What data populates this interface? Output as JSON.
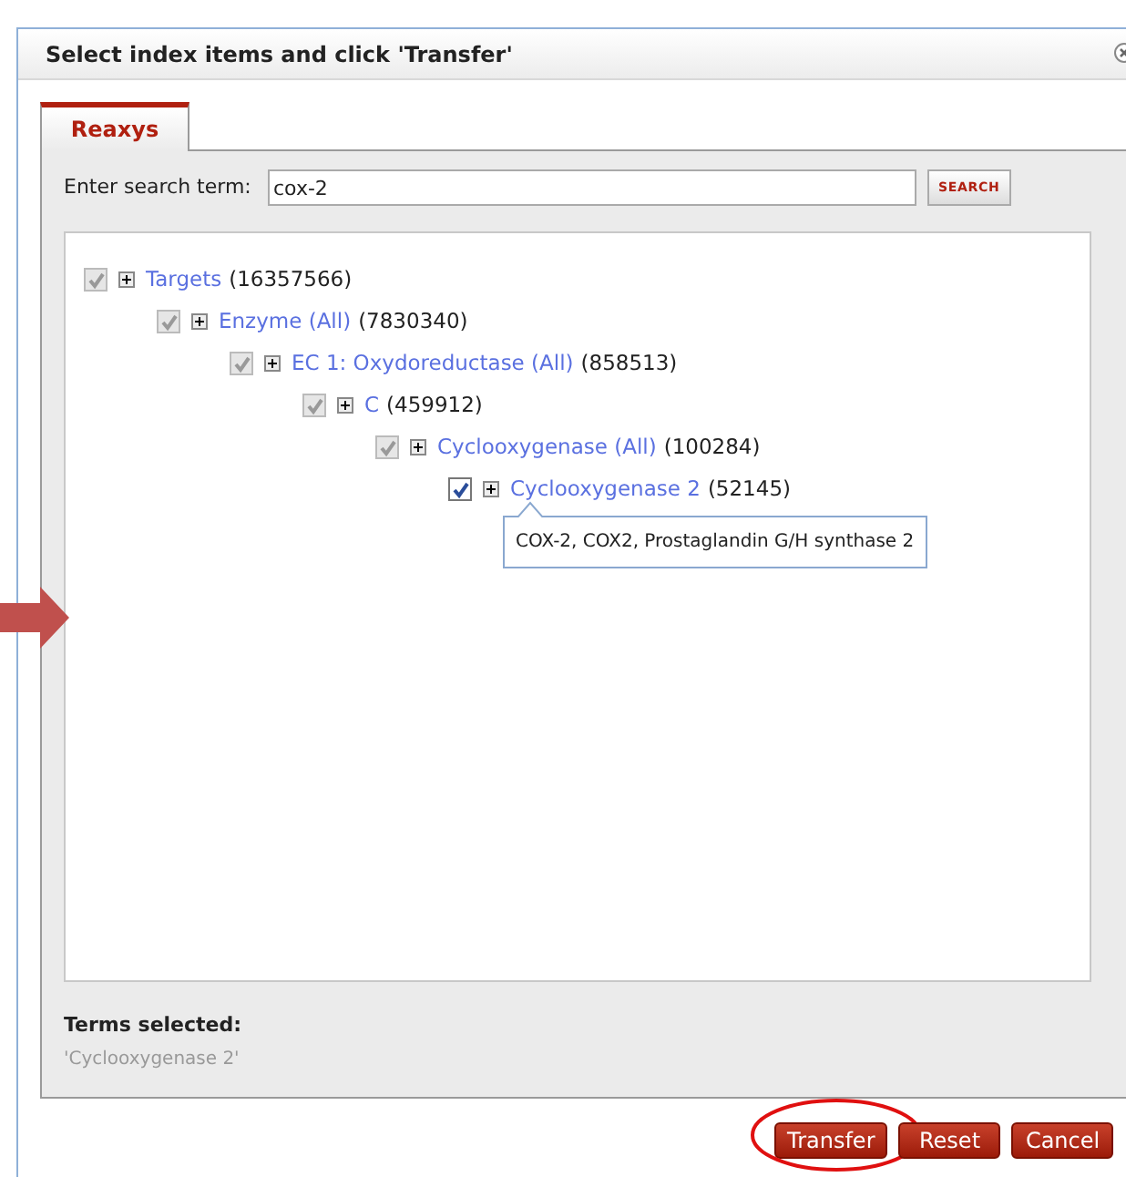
{
  "dialog": {
    "title": "Select index items and click 'Transfer'"
  },
  "tabs": [
    {
      "label": "Reaxys",
      "selected": true
    }
  ],
  "search": {
    "label": "Enter search term:",
    "value": "cox-2",
    "button": "SEARCH"
  },
  "tree": [
    {
      "label": "Targets",
      "count": "(16357566)",
      "checked": true,
      "inherited": true,
      "children": [
        {
          "label": "Enzyme (All)",
          "count": "(7830340)",
          "checked": true,
          "inherited": true,
          "children": [
            {
              "label": "EC 1: Oxydoreductase (All)",
              "count": "(858513)",
              "checked": true,
              "inherited": true,
              "children": [
                {
                  "label": "C",
                  "count": "(459912)",
                  "checked": true,
                  "inherited": true,
                  "children": [
                    {
                      "label": "Cyclooxygenase (All)",
                      "count": "(100284)",
                      "checked": true,
                      "inherited": true,
                      "children": [
                        {
                          "label": "Cyclooxygenase 2",
                          "count": "(52145)",
                          "checked": true,
                          "inherited": false,
                          "tooltip": "COX-2, COX2, Prostaglandin G/H synthase 2"
                        }
                      ]
                    }
                  ]
                }
              ]
            }
          ]
        }
      ]
    }
  ],
  "terms_selected": {
    "label": "Terms selected:",
    "value": "'Cyclooxygenase 2'"
  },
  "buttons": [
    {
      "label": "Transfer",
      "highlighted": true
    },
    {
      "label": "Reset",
      "highlighted": false
    },
    {
      "label": "Cancel",
      "highlighted": false
    }
  ]
}
